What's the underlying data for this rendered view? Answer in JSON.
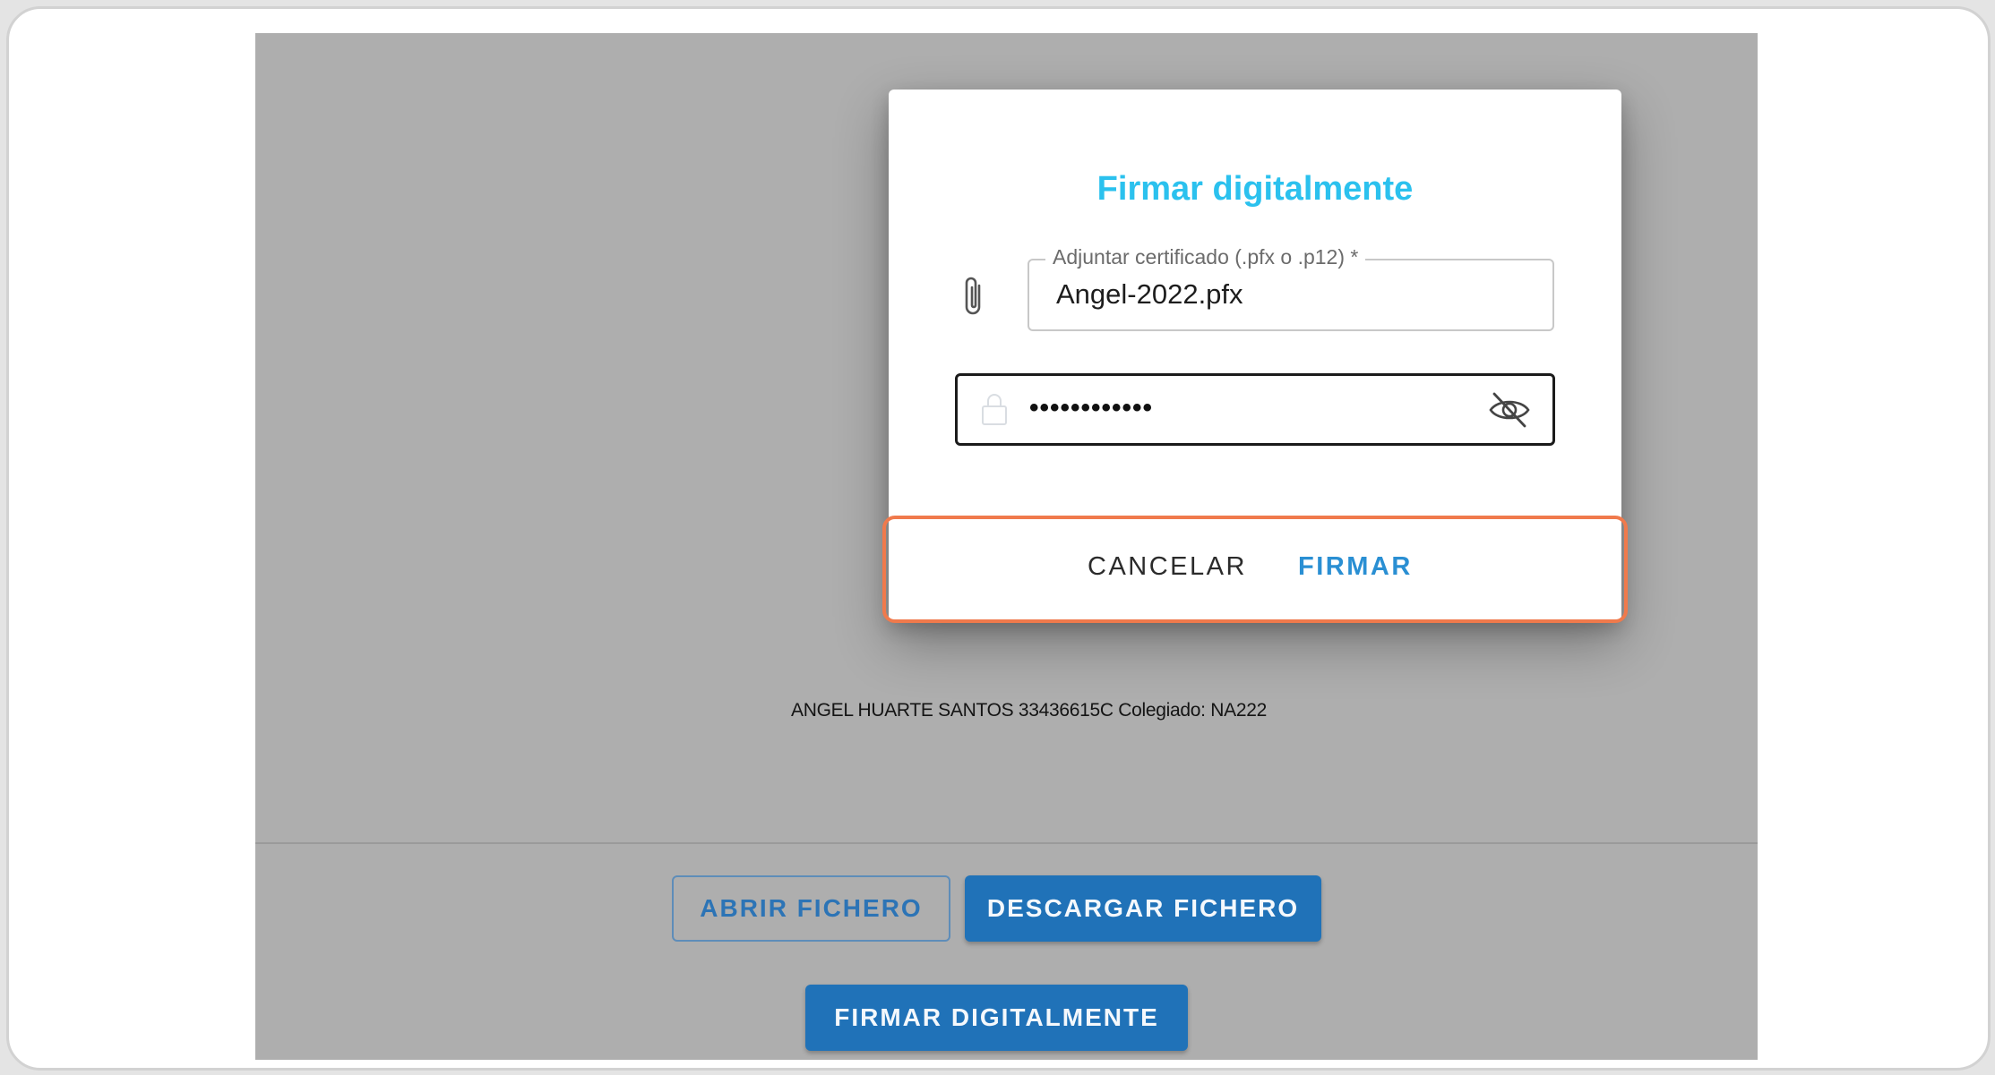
{
  "page": {
    "signature_text": "ANGEL HUARTE SANTOS 33436615C Colegiado: NA222",
    "buttons": {
      "open_file": "ABRIR FICHERO",
      "download_file": "DESCARGAR FICHERO",
      "sign_digitally": "FIRMAR DIGITALMENTE"
    }
  },
  "dialog": {
    "title": "Firmar digitalmente",
    "certificate_field": {
      "label": "Adjuntar certificado (.pfx o .p12) *",
      "value": "Angel-2022.pfx",
      "icon": "paperclip-icon"
    },
    "password_field": {
      "masked_value": "••••••••••••",
      "lock_icon": "lock-icon",
      "toggle_icon": "eye-off-icon"
    },
    "actions": {
      "cancel": "CANCELAR",
      "confirm": "FIRMAR"
    }
  },
  "colors": {
    "title": "#2bc1ee",
    "primary": "#2072b8",
    "highlight": "#f07a4c",
    "backdrop": "#aeaeae"
  }
}
